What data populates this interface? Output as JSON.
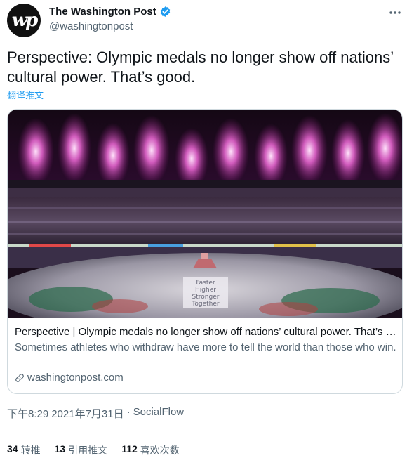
{
  "author": {
    "display_name": "The Washington Post",
    "handle": "@washingtonpost",
    "avatar_monogram": "wp",
    "verified_color": "#1d9bf0"
  },
  "tweet": {
    "text": "Perspective: Olympic medals no longer show off nations’ cultural power. That’s good.",
    "translate_label": "翻译推文"
  },
  "card": {
    "image_sign_lines": [
      "Faster",
      "Higher",
      "Stronger",
      "Together"
    ],
    "title": "Perspective | Olympic medals no longer show off nations’ cultural power. That’s good.",
    "description": "Sometimes athletes who withdraw have more to tell the world than those who win.",
    "domain": "washingtonpost.com"
  },
  "meta": {
    "time": "下午8:29",
    "date": "2021年7月31日",
    "separator": "·",
    "source": "SocialFlow"
  },
  "stats": {
    "retweets_count": "34",
    "retweets_label": "转推",
    "quotes_count": "13",
    "quotes_label": "引用推文",
    "likes_count": "112",
    "likes_label": "喜欢次数"
  },
  "colors": {
    "accent": "#1d9bf0",
    "text_primary": "#0f1419",
    "text_secondary": "#536471",
    "border": "#cfd9de"
  }
}
